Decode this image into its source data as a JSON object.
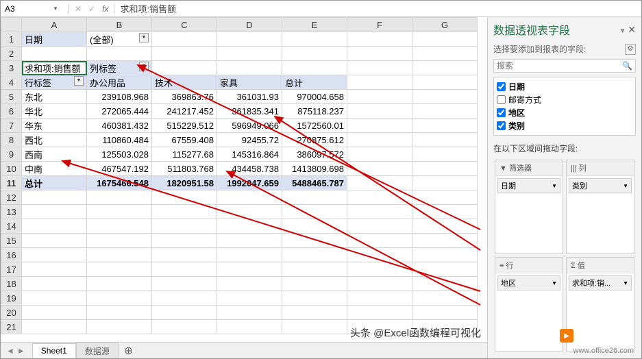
{
  "formula_bar": {
    "cell_ref": "A3",
    "fx_label": "fx",
    "formula_text": "求和项:销售额"
  },
  "columns": [
    "A",
    "B",
    "C",
    "D",
    "E",
    "F",
    "G"
  ],
  "row_numbers": [
    1,
    2,
    3,
    4,
    5,
    6,
    7,
    8,
    9,
    10,
    11,
    12,
    13,
    14,
    15,
    16,
    17,
    18,
    19,
    20,
    21
  ],
  "pivot": {
    "filter_label": "日期",
    "filter_value": "(全部)",
    "values_label": "求和项:销售额",
    "col_labels_label": "列标签",
    "row_labels_label": "行标签",
    "col_headers": [
      "办公用品",
      "技术",
      "家具",
      "总计"
    ],
    "rows": [
      {
        "label": "东北",
        "values": [
          "239108.968",
          "369863.76",
          "361031.93",
          "970004.658"
        ]
      },
      {
        "label": "华北",
        "values": [
          "272065.444",
          "241217.452",
          "361835.341",
          "875118.237"
        ]
      },
      {
        "label": "华东",
        "values": [
          "460381.432",
          "515229.512",
          "596949.066",
          "1572560.01"
        ]
      },
      {
        "label": "西北",
        "values": [
          "110860.484",
          "67559.408",
          "92455.72",
          "270875.612"
        ]
      },
      {
        "label": "西南",
        "values": [
          "125503.028",
          "115277.68",
          "145316.864",
          "386097.572"
        ]
      },
      {
        "label": "中南",
        "values": [
          "467547.192",
          "511803.768",
          "434458.738",
          "1413809.698"
        ]
      }
    ],
    "grand_total_label": "总计",
    "grand_totals": [
      "1675466.548",
      "1820951.58",
      "1992047.659",
      "5488465.787"
    ]
  },
  "sheet_tabs": {
    "active": "Sheet1",
    "other": "数据源"
  },
  "field_pane": {
    "title": "数据透视表字段",
    "subtitle": "选择要添加到报表的字段:",
    "search_placeholder": "搜索",
    "fields": [
      {
        "name": "日期",
        "checked": true,
        "bold": true
      },
      {
        "name": "邮寄方式",
        "checked": false,
        "bold": false
      },
      {
        "name": "地区",
        "checked": true,
        "bold": true
      },
      {
        "name": "类别",
        "checked": true,
        "bold": true
      }
    ],
    "areas_label": "在以下区域间拖动字段:",
    "areas": {
      "filters": {
        "header": "▼ 筛选器",
        "item": "日期"
      },
      "columns": {
        "header": "||| 列",
        "item": "类别"
      },
      "rows": {
        "header": "≡ 行",
        "item": "地区"
      },
      "values": {
        "header": "Σ 值",
        "item": "求和项:销..."
      }
    }
  },
  "watermark_main": "头条 @Excel函数编程可视化",
  "watermark_small": "www.office26.com",
  "chart_data": {
    "type": "table",
    "title": "求和项:销售额",
    "row_field": "地区",
    "column_field": "类别",
    "filter": {
      "field": "日期",
      "value": "(全部)"
    },
    "columns": [
      "办公用品",
      "技术",
      "家具",
      "总计"
    ],
    "rows": [
      {
        "label": "东北",
        "办公用品": 239108.968,
        "技术": 369863.76,
        "家具": 361031.93,
        "总计": 970004.658
      },
      {
        "label": "华北",
        "办公用品": 272065.444,
        "技术": 241217.452,
        "家具": 361835.341,
        "总计": 875118.237
      },
      {
        "label": "华东",
        "办公用品": 460381.432,
        "技术": 515229.512,
        "家具": 596949.066,
        "总计": 1572560.01
      },
      {
        "label": "西北",
        "办公用品": 110860.484,
        "技术": 67559.408,
        "家具": 92455.72,
        "总计": 270875.612
      },
      {
        "label": "西南",
        "办公用品": 125503.028,
        "技术": 115277.68,
        "家具": 145316.864,
        "总计": 386097.572
      },
      {
        "label": "中南",
        "办公用品": 467547.192,
        "技术": 511803.768,
        "家具": 434458.738,
        "总计": 1413809.698
      },
      {
        "label": "总计",
        "办公用品": 1675466.548,
        "技术": 1820951.58,
        "家具": 1992047.659,
        "总计": 5488465.787
      }
    ]
  }
}
